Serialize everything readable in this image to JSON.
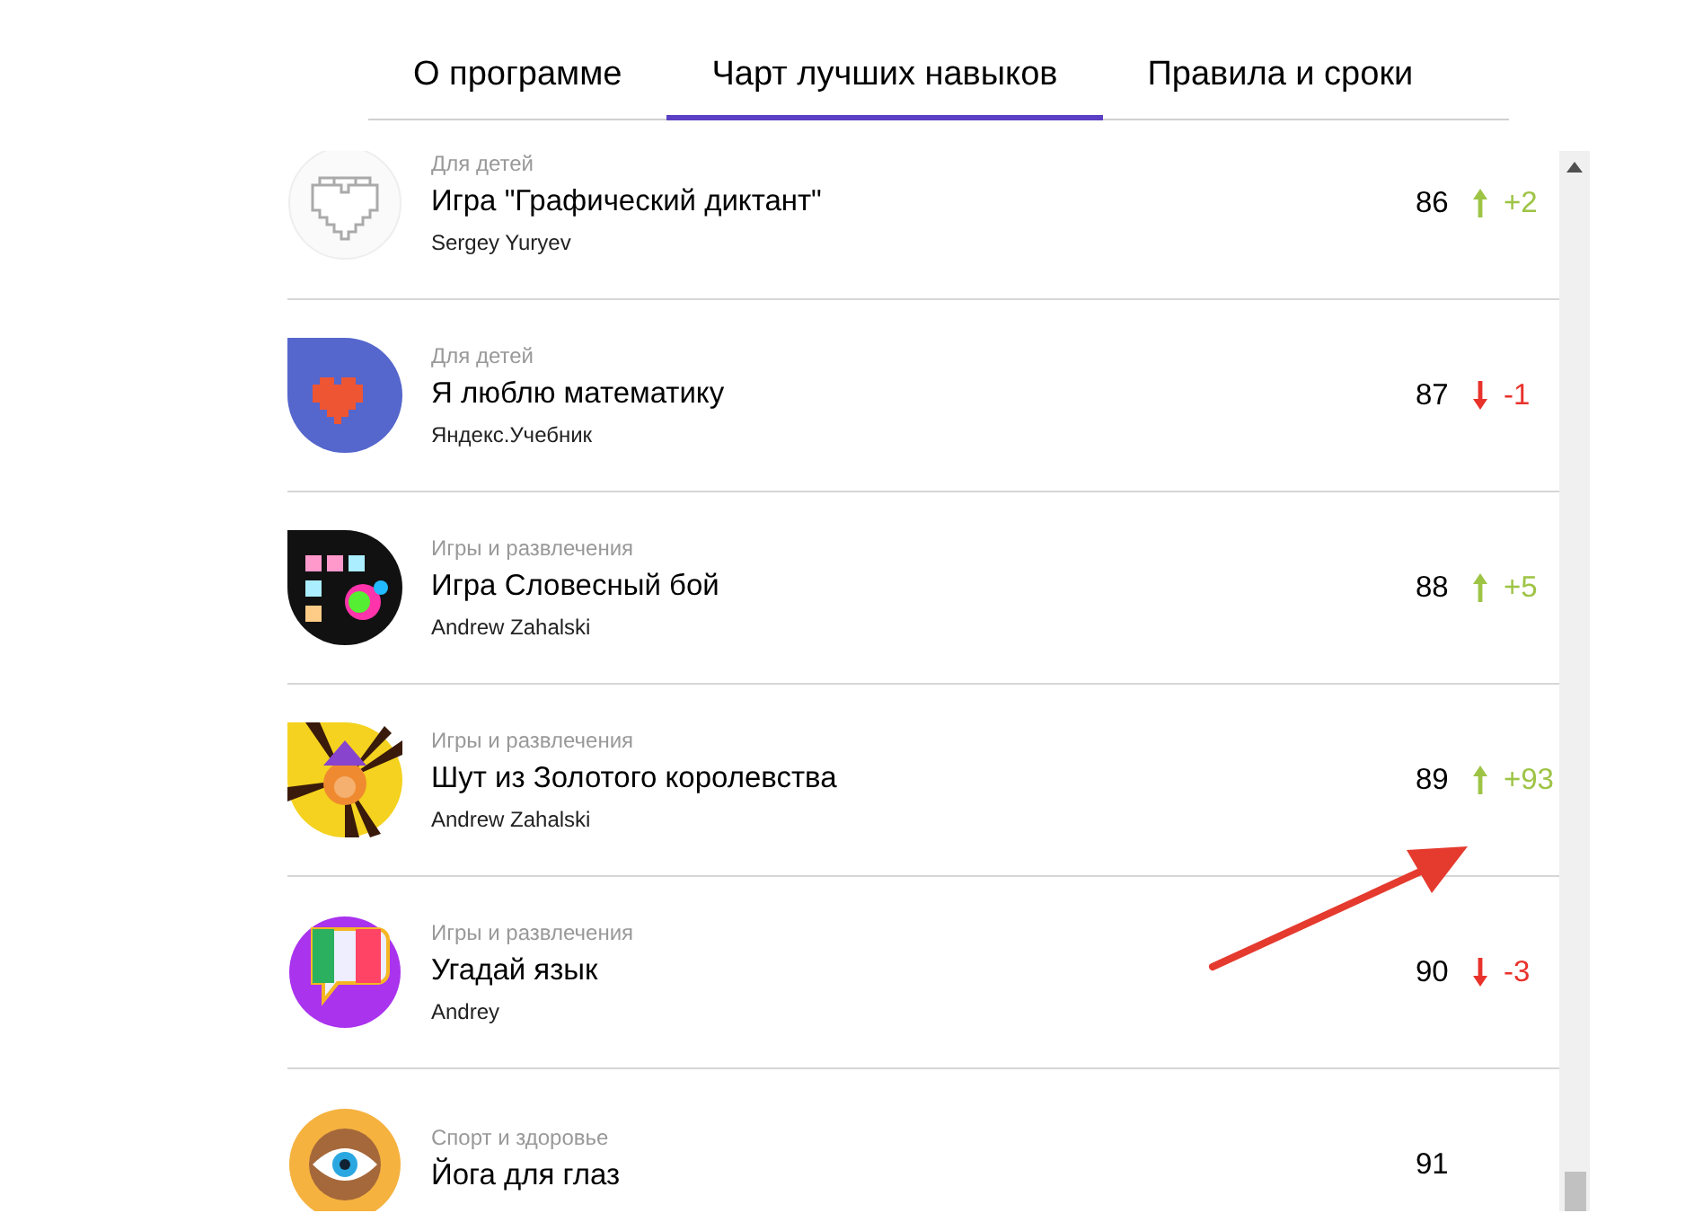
{
  "tabs": [
    {
      "label": "О программе",
      "selected": false
    },
    {
      "label": "Чарт лучших навыков",
      "selected": true
    },
    {
      "label": "Правила и сроки",
      "selected": false
    }
  ],
  "skills": [
    {
      "kind": "pixel-heart-outline",
      "category": "Для детей",
      "title": "Игра \"Графический диктант\"",
      "author": "Sergey Yuryev",
      "rank": "86",
      "rising": true,
      "change": "+2"
    },
    {
      "kind": "pixel-heart-drop",
      "category": "Для детей",
      "title": "Я люблю математику",
      "author": "Яндекс.Учебник",
      "rank": "87",
      "rising": false,
      "change": "-1"
    },
    {
      "kind": "letter-blocks",
      "category": "Игры и развлечения",
      "title": "Игра Словесный бой",
      "author": "Andrew Zahalski",
      "rank": "88",
      "rising": true,
      "change": "+5"
    },
    {
      "kind": "jester",
      "category": "Игры и развлечения",
      "title": "Шут из Золотого королевства",
      "author": "Andrew Zahalski",
      "rank": "89",
      "rising": true,
      "change": "+93"
    },
    {
      "kind": "speech-flag",
      "category": "Игры и развлечения",
      "title": "Угадай язык",
      "author": "Andrey",
      "rank": "90",
      "rising": false,
      "change": "-3"
    },
    {
      "kind": "eye",
      "category": "Спорт и здоровье",
      "title": "Йога для глаз",
      "rank": "91"
    }
  ],
  "annotations": [
    {
      "kind": "arrow"
    }
  ]
}
